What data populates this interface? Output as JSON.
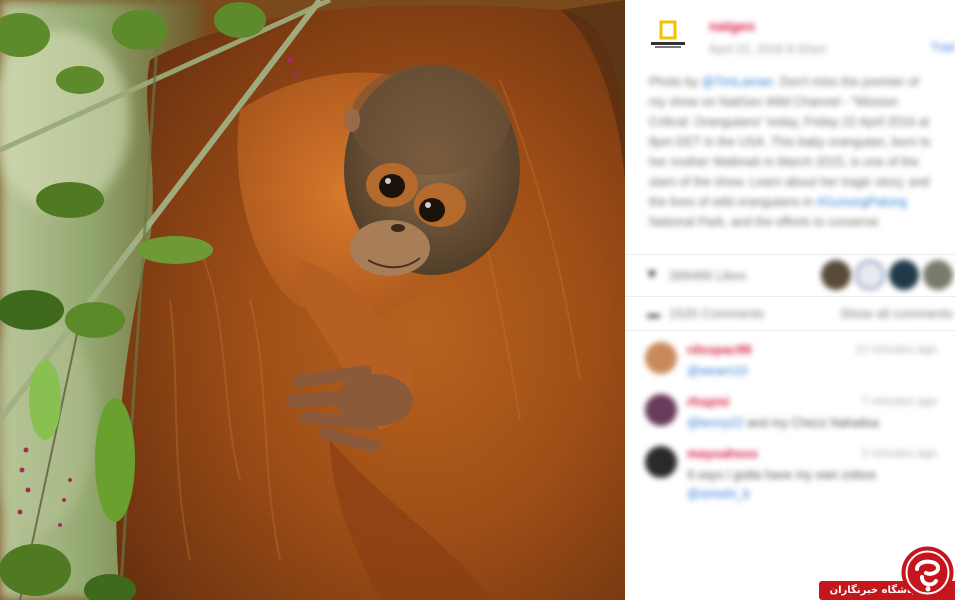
{
  "post": {
    "username": "natgeo",
    "date": "April 22, 2016 8:32am",
    "translate_label": "Trad",
    "caption_parts": [
      {
        "text": "Photo by ",
        "u": false
      },
      {
        "text": "@TimLaman",
        "u": true
      },
      {
        "text": ". Don't miss the premier of my show on NatGeo Wild Channel - \"Mission Critical: Orangutans\" today, Friday 22 April 2016 at 8pm EET in the USA. This baby orangutan, born to her mother Walimah in March 2015, is one of the stars of the show. Learn about her tragic story, and the lives of wild orangutans in ",
        "u": false
      },
      {
        "text": "#GunungPalung",
        "u": true
      },
      {
        "text": " National Park, and the efforts to conserve",
        "u": false
      }
    ],
    "likes_text": "389486 Likes",
    "comments_count": "1520 Comments",
    "show_all_label": "Show all comments"
  },
  "comments": [
    {
      "user": "rdsspac99",
      "time": "12 minutes ago",
      "parts": [
        {
          "text": "@wearn10",
          "u": true
        }
      ]
    },
    {
      "user": "rhspisi",
      "time": "7 minutes ago",
      "parts": [
        {
          "text": "@lenny22",
          "u": true
        },
        {
          "text": " and my Chezz Nahailsa",
          "u": false
        }
      ]
    },
    {
      "user": "mayoahsss",
      "time": "2 minutes ago",
      "parts": [
        {
          "text": "It says I gotta have my own zoboo ",
          "u": false
        },
        {
          "text": "@simahi_b",
          "u": true
        }
      ]
    }
  ],
  "watermark": {
    "text": "باشگاه خبرنگاران"
  },
  "colors": {
    "username": "#d81b42",
    "link": "#2f7fd4",
    "watermark": "#c4161c"
  }
}
